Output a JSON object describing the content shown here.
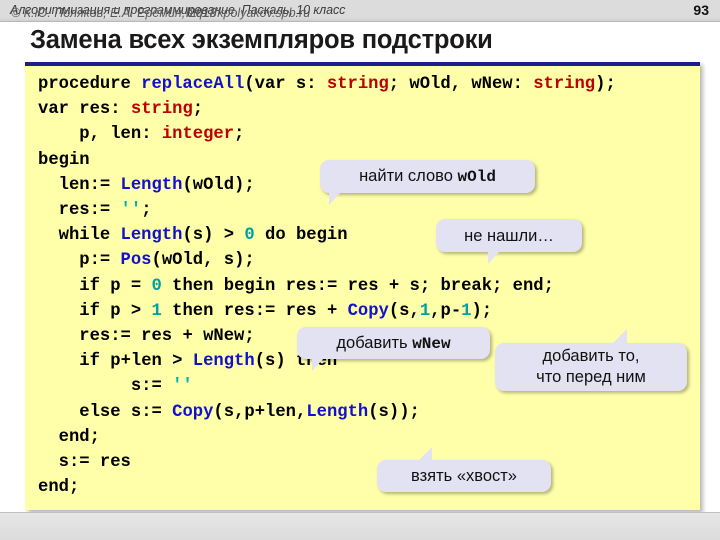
{
  "header": {
    "course": "Алгоритмизация и программирование, Паскаль, 10 класс",
    "page_number": "93"
  },
  "slide": {
    "title": "Замена всех экземпляров подстроки"
  },
  "code": {
    "language": "pascal",
    "lines": [
      "procedure replaceAll(var s: string; wOld, wNew: string);",
      "var res: string;",
      "    p, len: integer;",
      "begin",
      "  len:= Length(wOld);",
      "  res:= '';",
      "  while Length(s) > 0 do begin",
      "    p:= Pos(wOld, s);",
      "    if p = 0 then begin res:= res + s; break; end;",
      "    if p > 1 then res:= res + Copy(s,1,p-1);",
      "    res:= res + wNew;",
      "    if p+len > Length(s) then",
      "         s:= ''",
      "    else s:= Copy(s,p+len,Length(s));",
      "  end;",
      "  s:= res",
      "end;"
    ],
    "colors": {
      "background": "#ffffaa",
      "border_top": "#1d1d8c",
      "keyword": "#000000",
      "type": "#bb0000",
      "function": "#1111cc",
      "number": "#00a0a0",
      "string": "#00b0b0"
    }
  },
  "callouts": [
    {
      "id": "find",
      "text_plain": "найти слово ",
      "text_code": "wOld"
    },
    {
      "id": "notfound",
      "text_plain": "не нашли…",
      "text_code": ""
    },
    {
      "id": "addnew",
      "text_plain": "добавить ",
      "text_code": "wNew"
    },
    {
      "id": "addbefore",
      "line1": "добавить то,",
      "line2": "что перед ним"
    },
    {
      "id": "tail",
      "text_plain": "взять «хвост»",
      "text_code": ""
    }
  ],
  "footer": {
    "copyright": "© К.Ю. Поляков, Е.А. Ерёмин, 2018",
    "url": "http://kpolyakov.spb.ru"
  }
}
